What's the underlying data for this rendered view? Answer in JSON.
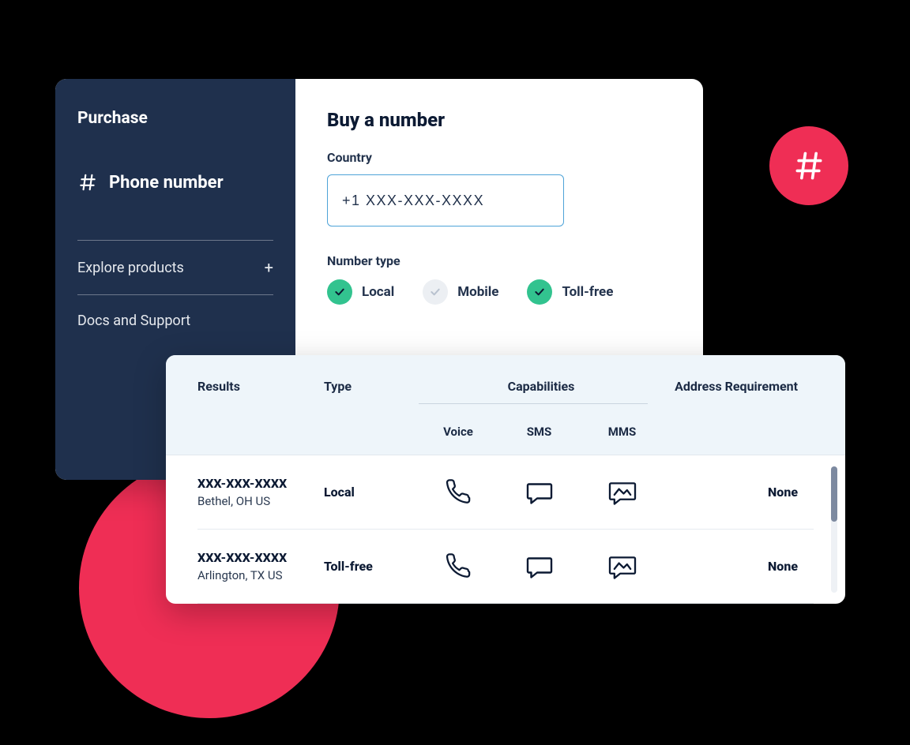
{
  "sidebar": {
    "title": "Purchase",
    "product_label": "Phone number",
    "explore_label": "Explore products",
    "explore_plus": "+",
    "docs_label": "Docs and Support"
  },
  "content": {
    "title": "Buy a number",
    "country_label": "Country",
    "country_value": "+1 XXX-XXX-XXXX",
    "number_type_label": "Number type",
    "types": {
      "local": {
        "label": "Local",
        "checked": true
      },
      "mobile": {
        "label": "Mobile",
        "checked": false
      },
      "tollfree": {
        "label": "Toll-free",
        "checked": true
      }
    }
  },
  "results": {
    "headers": {
      "results": "Results",
      "type": "Type",
      "capabilities": "Capabilities",
      "voice": "Voice",
      "sms": "SMS",
      "mms": "MMS",
      "address": "Address Requirement"
    },
    "rows": [
      {
        "number": "XXX-XXX-XXXX",
        "location": "Bethel, OH US",
        "type": "Local",
        "address_req": "None"
      },
      {
        "number": "XXX-XXX-XXXX",
        "location": "Arlington, TX US",
        "type": "Toll-free",
        "address_req": "None"
      }
    ]
  }
}
